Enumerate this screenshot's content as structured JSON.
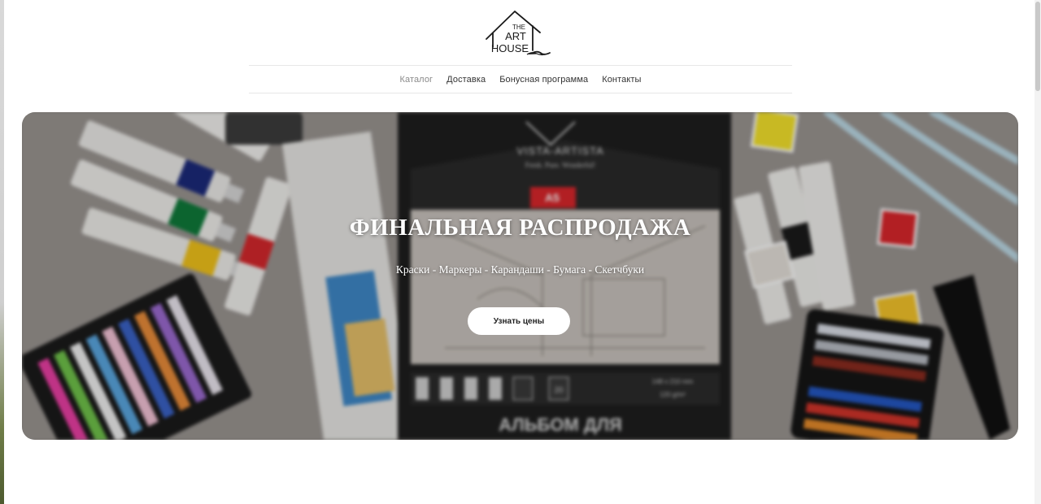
{
  "brand": {
    "logo_line1": "THE",
    "logo_line2": "ART",
    "logo_line3": "HOUSE"
  },
  "nav": {
    "items": [
      {
        "label": "Каталог",
        "active": true
      },
      {
        "label": "Доставка",
        "active": false
      },
      {
        "label": "Бонусная программа",
        "active": false
      },
      {
        "label": "Контакты",
        "active": false
      }
    ]
  },
  "hero": {
    "title": "ФИНАЛЬНАЯ РАСПРОДАЖА",
    "subtitle": "Краски - Маркеры - Карандаши - Бумага - Скетчбуки",
    "button_label": "Узнать цены",
    "album_brand": "VISTA-ARTISTA",
    "album_tagline": "Fresh. Pure. Wonderful!",
    "album_format": "A5",
    "album_size": "148 x 210 mm",
    "album_weight": "120 g/m²",
    "album_count": "20",
    "album_title": "АЛЬБОМ ДЛЯ"
  },
  "colors": {
    "nav_active": "#8a8a8a",
    "nav_text": "#333333",
    "hero_button_bg": "#ffffff"
  }
}
